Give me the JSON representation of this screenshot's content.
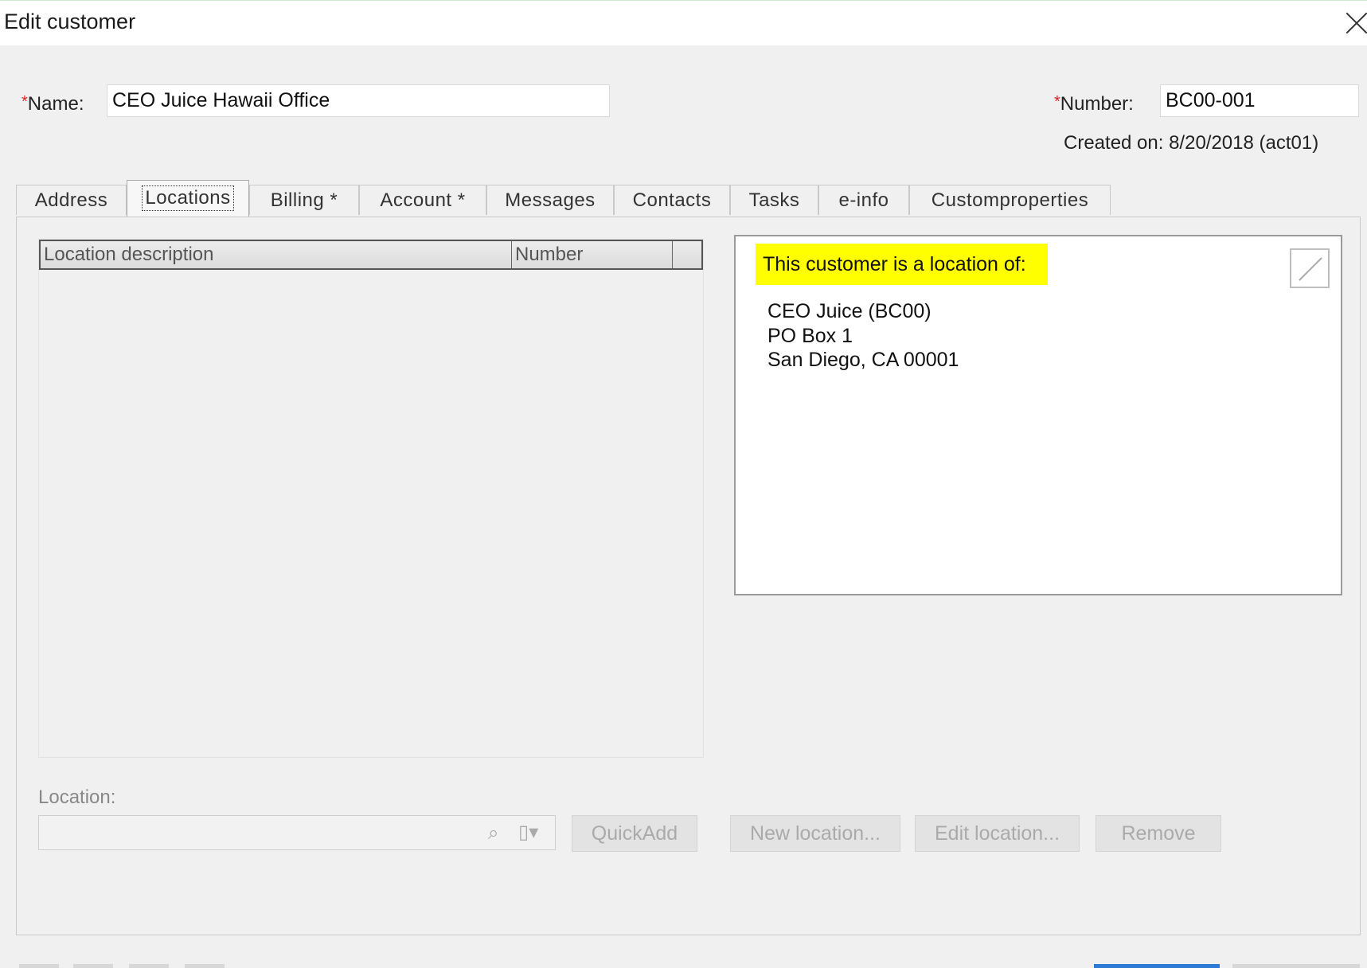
{
  "window": {
    "title": "Edit customer"
  },
  "form": {
    "name_label": "Name:",
    "name_value": "CEO Juice Hawaii Office",
    "number_label": "Number:",
    "number_value": "BC00-001",
    "required_marker": "*",
    "created_on": "Created on: 8/20/2018 (act01)"
  },
  "tabs": [
    {
      "label": "Address",
      "active": false
    },
    {
      "label": "Locations",
      "active": true
    },
    {
      "label": "Billing  *",
      "active": false
    },
    {
      "label": "Account *",
      "active": false
    },
    {
      "label": "Messages",
      "active": false
    },
    {
      "label": "Contacts",
      "active": false
    },
    {
      "label": "Tasks",
      "active": false
    },
    {
      "label": "e-info",
      "active": false
    },
    {
      "label": "Customproperties",
      "active": false
    }
  ],
  "locations_grid": {
    "columns": [
      "Location description",
      "Number"
    ]
  },
  "location_of": {
    "heading": "This customer is a location of:",
    "name": "CEO Juice (BC00)",
    "address": "PO Box 1",
    "city": "San Diego, CA 00001",
    "highlight_color": "#ffff00"
  },
  "location_field": {
    "label": "Location:",
    "value": ""
  },
  "buttons": {
    "quickadd": "QuickAdd",
    "new_location": "New location...",
    "edit_location": "Edit location...",
    "remove": "Remove"
  },
  "colors": {
    "required": "#dd2222",
    "primary_button": "#2d7bd6"
  },
  "icons": {
    "close": "close-icon",
    "edit": "edit-pencil-icon",
    "search": "search-icon",
    "lookup_dropdown": "lookup-dropdown-icon"
  }
}
